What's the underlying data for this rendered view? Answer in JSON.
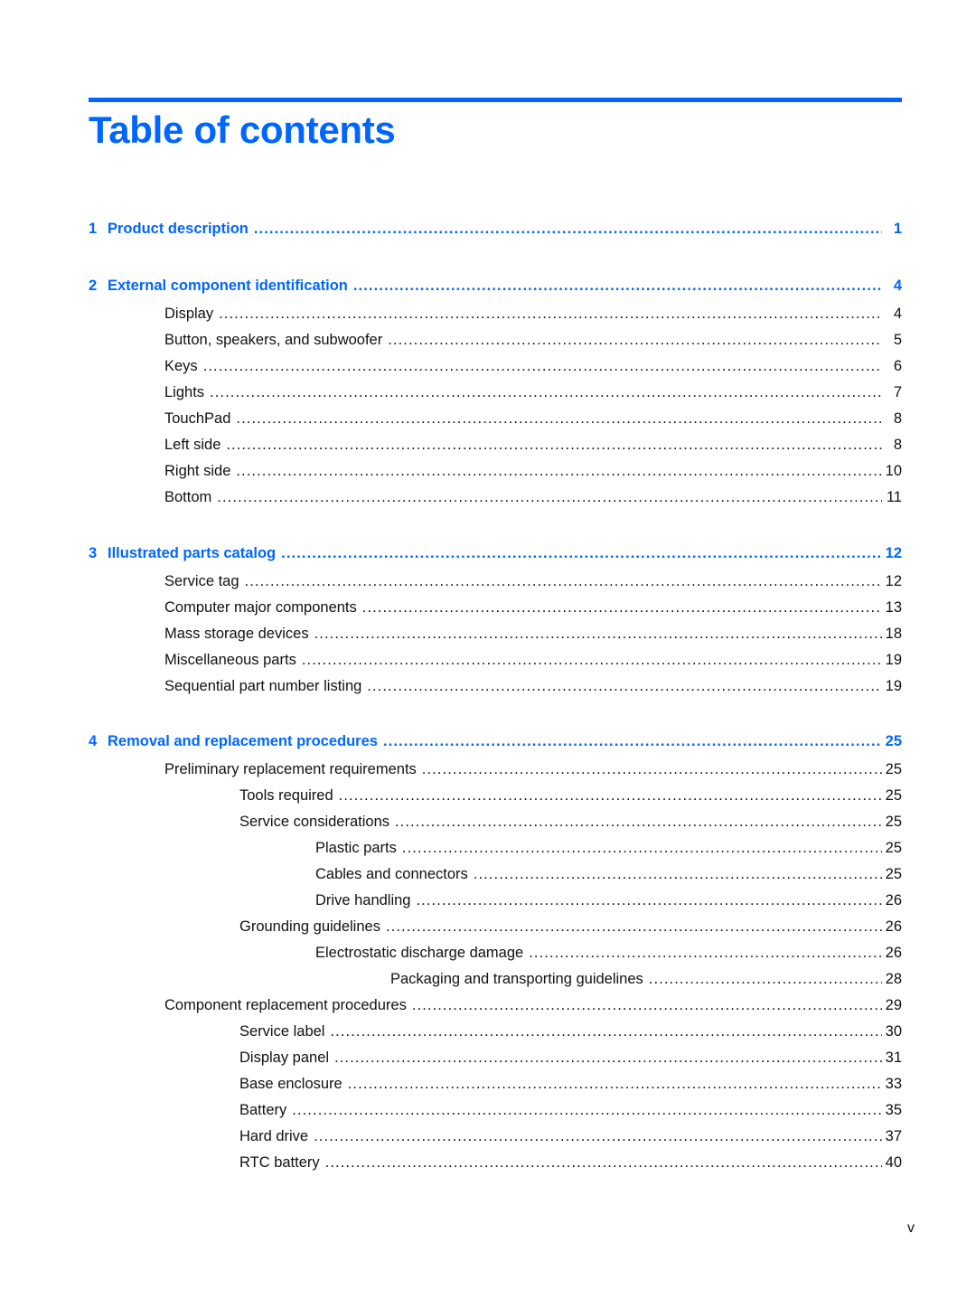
{
  "title": "Table of contents",
  "accent_color": "#0066ff",
  "footer_page": "v",
  "entries": [
    {
      "level": 0,
      "num": "1",
      "label": "Product description",
      "page": "1"
    },
    {
      "level": 0,
      "num": "2",
      "label": "External component identification",
      "page": "4"
    },
    {
      "level": 1,
      "label": "Display",
      "page": "4"
    },
    {
      "level": 1,
      "label": "Button, speakers, and subwoofer",
      "page": "5"
    },
    {
      "level": 1,
      "label": "Keys",
      "page": "6"
    },
    {
      "level": 1,
      "label": "Lights",
      "page": "7"
    },
    {
      "level": 1,
      "label": "TouchPad",
      "page": "8"
    },
    {
      "level": 1,
      "label": "Left side",
      "page": "8"
    },
    {
      "level": 1,
      "label": "Right side",
      "page": "10"
    },
    {
      "level": 1,
      "label": "Bottom",
      "page": "11"
    },
    {
      "level": 0,
      "num": "3",
      "label": "Illustrated parts catalog",
      "page": "12"
    },
    {
      "level": 1,
      "label": "Service tag",
      "page": "12"
    },
    {
      "level": 1,
      "label": "Computer major components",
      "page": "13"
    },
    {
      "level": 1,
      "label": "Mass storage devices",
      "page": "18"
    },
    {
      "level": 1,
      "label": "Miscellaneous parts",
      "page": "19"
    },
    {
      "level": 1,
      "label": "Sequential part number listing",
      "page": "19"
    },
    {
      "level": 0,
      "num": "4",
      "label": "Removal and replacement procedures",
      "page": "25"
    },
    {
      "level": 1,
      "label": "Preliminary replacement requirements",
      "page": "25"
    },
    {
      "level": 2,
      "label": "Tools required",
      "page": "25"
    },
    {
      "level": 2,
      "label": "Service considerations",
      "page": "25"
    },
    {
      "level": 3,
      "label": "Plastic parts",
      "page": "25"
    },
    {
      "level": 3,
      "label": "Cables and connectors",
      "page": "25"
    },
    {
      "level": 3,
      "label": "Drive handling",
      "page": "26"
    },
    {
      "level": 2,
      "label": "Grounding guidelines",
      "page": "26"
    },
    {
      "level": 3,
      "label": "Electrostatic discharge damage",
      "page": "26"
    },
    {
      "level": 4,
      "label": "Packaging and transporting guidelines",
      "page": "28"
    },
    {
      "level": 1,
      "label": "Component replacement procedures",
      "page": "29"
    },
    {
      "level": 2,
      "label": "Service label",
      "page": "30"
    },
    {
      "level": 2,
      "label": "Display panel",
      "page": "31"
    },
    {
      "level": 2,
      "label": "Base enclosure",
      "page": "33"
    },
    {
      "level": 2,
      "label": "Battery",
      "page": "35"
    },
    {
      "level": 2,
      "label": "Hard drive",
      "page": "37"
    },
    {
      "level": 2,
      "label": "RTC battery",
      "page": "40"
    }
  ]
}
